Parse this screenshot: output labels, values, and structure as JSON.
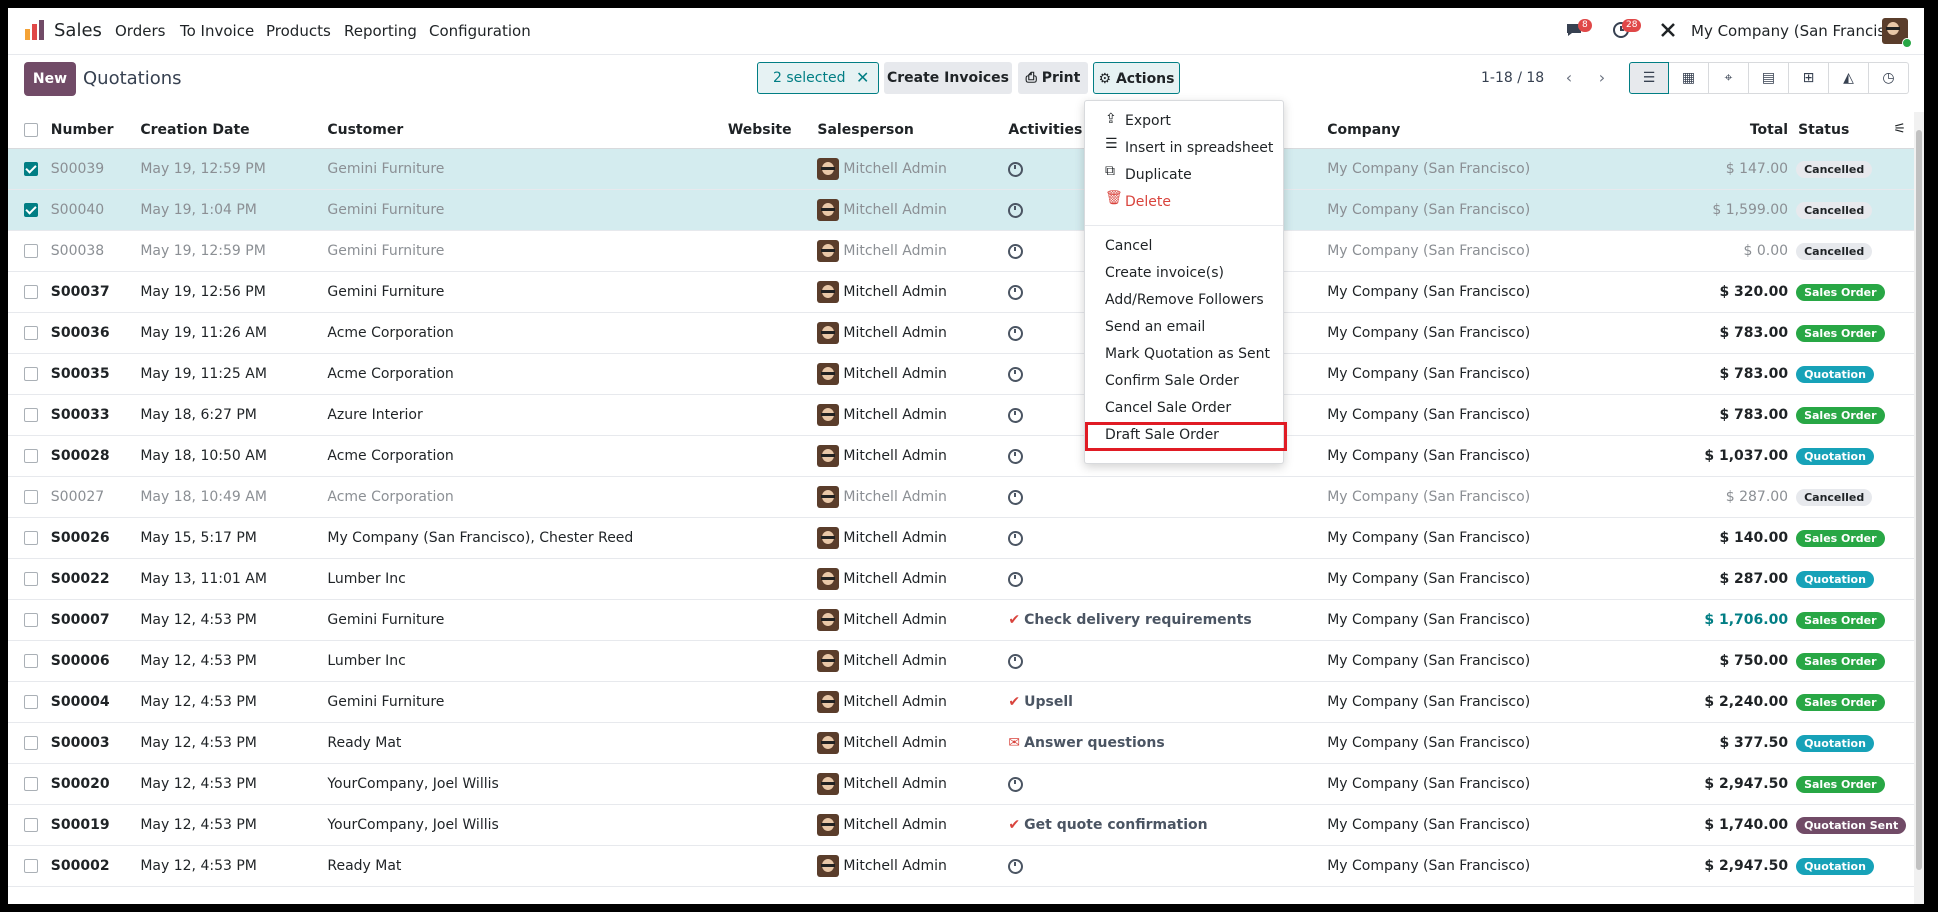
{
  "navbar": {
    "app_name": "Sales",
    "menu": [
      "Orders",
      "To Invoice",
      "Products",
      "Reporting",
      "Configuration"
    ],
    "messages_count": "8",
    "activities_count": "28",
    "company": "My Company (San Francisco)"
  },
  "control_panel": {
    "new_label": "New",
    "title": "Quotations",
    "selected_label": "2 selected",
    "create_invoices_label": "Create Invoices",
    "print_label": "Print",
    "actions_label": "Actions",
    "pager": "1-18 / 18"
  },
  "table": {
    "headers": [
      "Number",
      "Creation Date",
      "Customer",
      "Website",
      "Salesperson",
      "Activities",
      "Company",
      "Total",
      "Status"
    ],
    "rows": [
      {
        "number": "S00039",
        "date": "May 19, 12:59 PM",
        "customer": "Gemini Furniture",
        "salesperson": "Mitchell Admin",
        "activity": "",
        "company": "My Company (San Francisco)",
        "total": "$ 147.00",
        "status": "Cancelled"
      },
      {
        "number": "S00040",
        "date": "May 19, 1:04 PM",
        "customer": "Gemini Furniture",
        "salesperson": "Mitchell Admin",
        "activity": "",
        "company": "My Company (San Francisco)",
        "total": "$ 1,599.00",
        "status": "Cancelled"
      },
      {
        "number": "S00038",
        "date": "May 19, 12:59 PM",
        "customer": "Gemini Furniture",
        "salesperson": "Mitchell Admin",
        "activity": "",
        "company": "My Company (San Francisco)",
        "total": "$ 0.00",
        "status": "Cancelled"
      },
      {
        "number": "S00037",
        "date": "May 19, 12:56 PM",
        "customer": "Gemini Furniture",
        "salesperson": "Mitchell Admin",
        "activity": "",
        "company": "My Company (San Francisco)",
        "total": "$ 320.00",
        "status": "Sales Order"
      },
      {
        "number": "S00036",
        "date": "May 19, 11:26 AM",
        "customer": "Acme Corporation",
        "salesperson": "Mitchell Admin",
        "activity": "",
        "company": "My Company (San Francisco)",
        "total": "$ 783.00",
        "status": "Sales Order"
      },
      {
        "number": "S00035",
        "date": "May 19, 11:25 AM",
        "customer": "Acme Corporation",
        "salesperson": "Mitchell Admin",
        "activity": "",
        "company": "My Company (San Francisco)",
        "total": "$ 783.00",
        "status": "Quotation"
      },
      {
        "number": "S00033",
        "date": "May 18, 6:27 PM",
        "customer": "Azure Interior",
        "salesperson": "Mitchell Admin",
        "activity": "",
        "company": "My Company (San Francisco)",
        "total": "$ 783.00",
        "status": "Sales Order"
      },
      {
        "number": "S00028",
        "date": "May 18, 10:50 AM",
        "customer": "Acme Corporation",
        "salesperson": "Mitchell Admin",
        "activity": "",
        "company": "My Company (San Francisco)",
        "total": "$ 1,037.00",
        "status": "Quotation"
      },
      {
        "number": "S00027",
        "date": "May 18, 10:49 AM",
        "customer": "Acme Corporation",
        "salesperson": "Mitchell Admin",
        "activity": "",
        "company": "My Company (San Francisco)",
        "total": "$ 287.00",
        "status": "Cancelled"
      },
      {
        "number": "S00026",
        "date": "May 15, 5:17 PM",
        "customer": "My Company (San Francisco), Chester Reed",
        "salesperson": "Mitchell Admin",
        "activity": "",
        "company": "My Company (San Francisco)",
        "total": "$ 140.00",
        "status": "Sales Order"
      },
      {
        "number": "S00022",
        "date": "May 13, 11:01 AM",
        "customer": "Lumber Inc",
        "salesperson": "Mitchell Admin",
        "activity": "",
        "company": "My Company (San Francisco)",
        "total": "$ 287.00",
        "status": "Quotation"
      },
      {
        "number": "S00007",
        "date": "May 12, 4:53 PM",
        "customer": "Gemini Furniture",
        "salesperson": "Mitchell Admin",
        "activity": "Check delivery requirements",
        "company": "My Company (San Francisco)",
        "total": "$ 1,706.00",
        "status": "Sales Order"
      },
      {
        "number": "S00006",
        "date": "May 12, 4:53 PM",
        "customer": "Lumber Inc",
        "salesperson": "Mitchell Admin",
        "activity": "",
        "company": "My Company (San Francisco)",
        "total": "$ 750.00",
        "status": "Sales Order"
      },
      {
        "number": "S00004",
        "date": "May 12, 4:53 PM",
        "customer": "Gemini Furniture",
        "salesperson": "Mitchell Admin",
        "activity": "Upsell",
        "company": "My Company (San Francisco)",
        "total": "$ 2,240.00",
        "status": "Sales Order"
      },
      {
        "number": "S00003",
        "date": "May 12, 4:53 PM",
        "customer": "Ready Mat",
        "salesperson": "Mitchell Admin",
        "activity": "Answer questions",
        "company": "My Company (San Francisco)",
        "total": "$ 377.50",
        "status": "Quotation"
      },
      {
        "number": "S00020",
        "date": "May 12, 4:53 PM",
        "customer": "YourCompany, Joel Willis",
        "salesperson": "Mitchell Admin",
        "activity": "",
        "company": "My Company (San Francisco)",
        "total": "$ 2,947.50",
        "status": "Sales Order"
      },
      {
        "number": "S00019",
        "date": "May 12, 4:53 PM",
        "customer": "YourCompany, Joel Willis",
        "salesperson": "Mitchell Admin",
        "activity": "Get quote confirmation",
        "company": "My Company (San Francisco)",
        "total": "$ 1,740.00",
        "status": "Quotation Sent"
      },
      {
        "number": "S00002",
        "date": "May 12, 4:53 PM",
        "customer": "Ready Mat",
        "salesperson": "Mitchell Admin",
        "activity": "",
        "company": "My Company (San Francisco)",
        "total": "$ 2,947.50",
        "status": "Quotation"
      }
    ]
  },
  "actions_menu": {
    "export": "Export",
    "insert": "Insert in spreadsheet",
    "duplicate": "Duplicate",
    "delete": "Delete",
    "cancel": "Cancel",
    "create_invoices": "Create invoice(s)",
    "followers": "Add/Remove Followers",
    "send_email": "Send an email",
    "mark_sent": "Mark Quotation as Sent",
    "confirm": "Confirm Sale Order",
    "cancel_order": "Cancel Sale Order",
    "draft": "Draft Sale Order"
  },
  "colors": {
    "brand": "#714b67",
    "accent": "#017e84",
    "highlight": "#e01b24"
  }
}
